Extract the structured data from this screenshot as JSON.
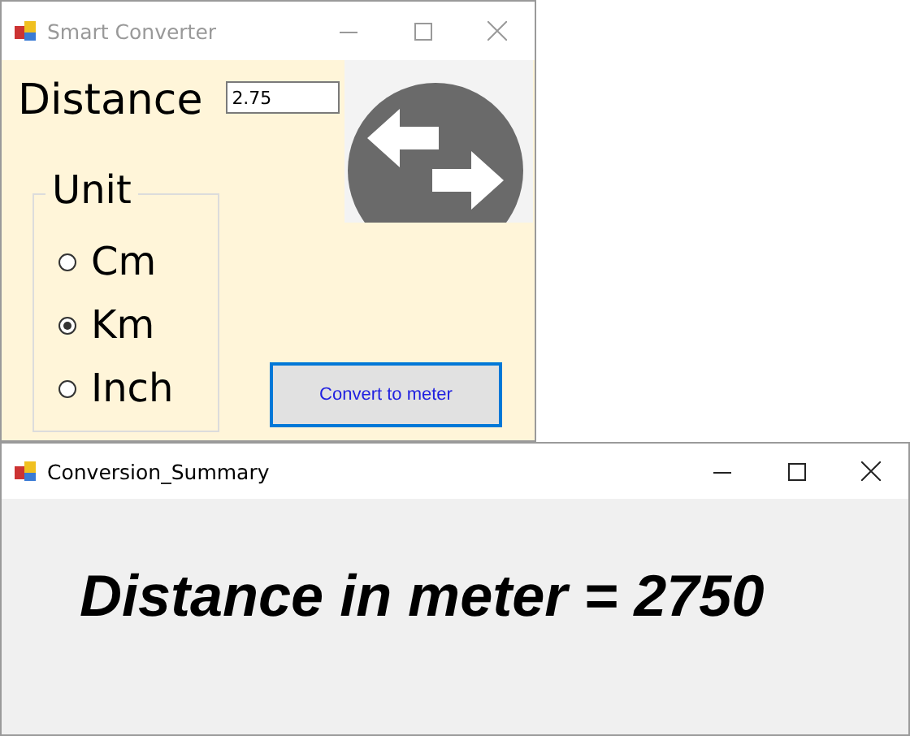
{
  "windows": [
    {
      "title": "Smart Converter",
      "distance": {
        "label": "Distance",
        "value": "2.75"
      },
      "unit_group": {
        "title": "Unit",
        "options": [
          {
            "label": "Cm",
            "selected": false
          },
          {
            "label": "Km",
            "selected": true
          },
          {
            "label": "Inch",
            "selected": false
          }
        ]
      },
      "button": "Convert to meter"
    },
    {
      "title": "Conversion_Summary",
      "result": "Distance in meter = 2750"
    }
  ]
}
